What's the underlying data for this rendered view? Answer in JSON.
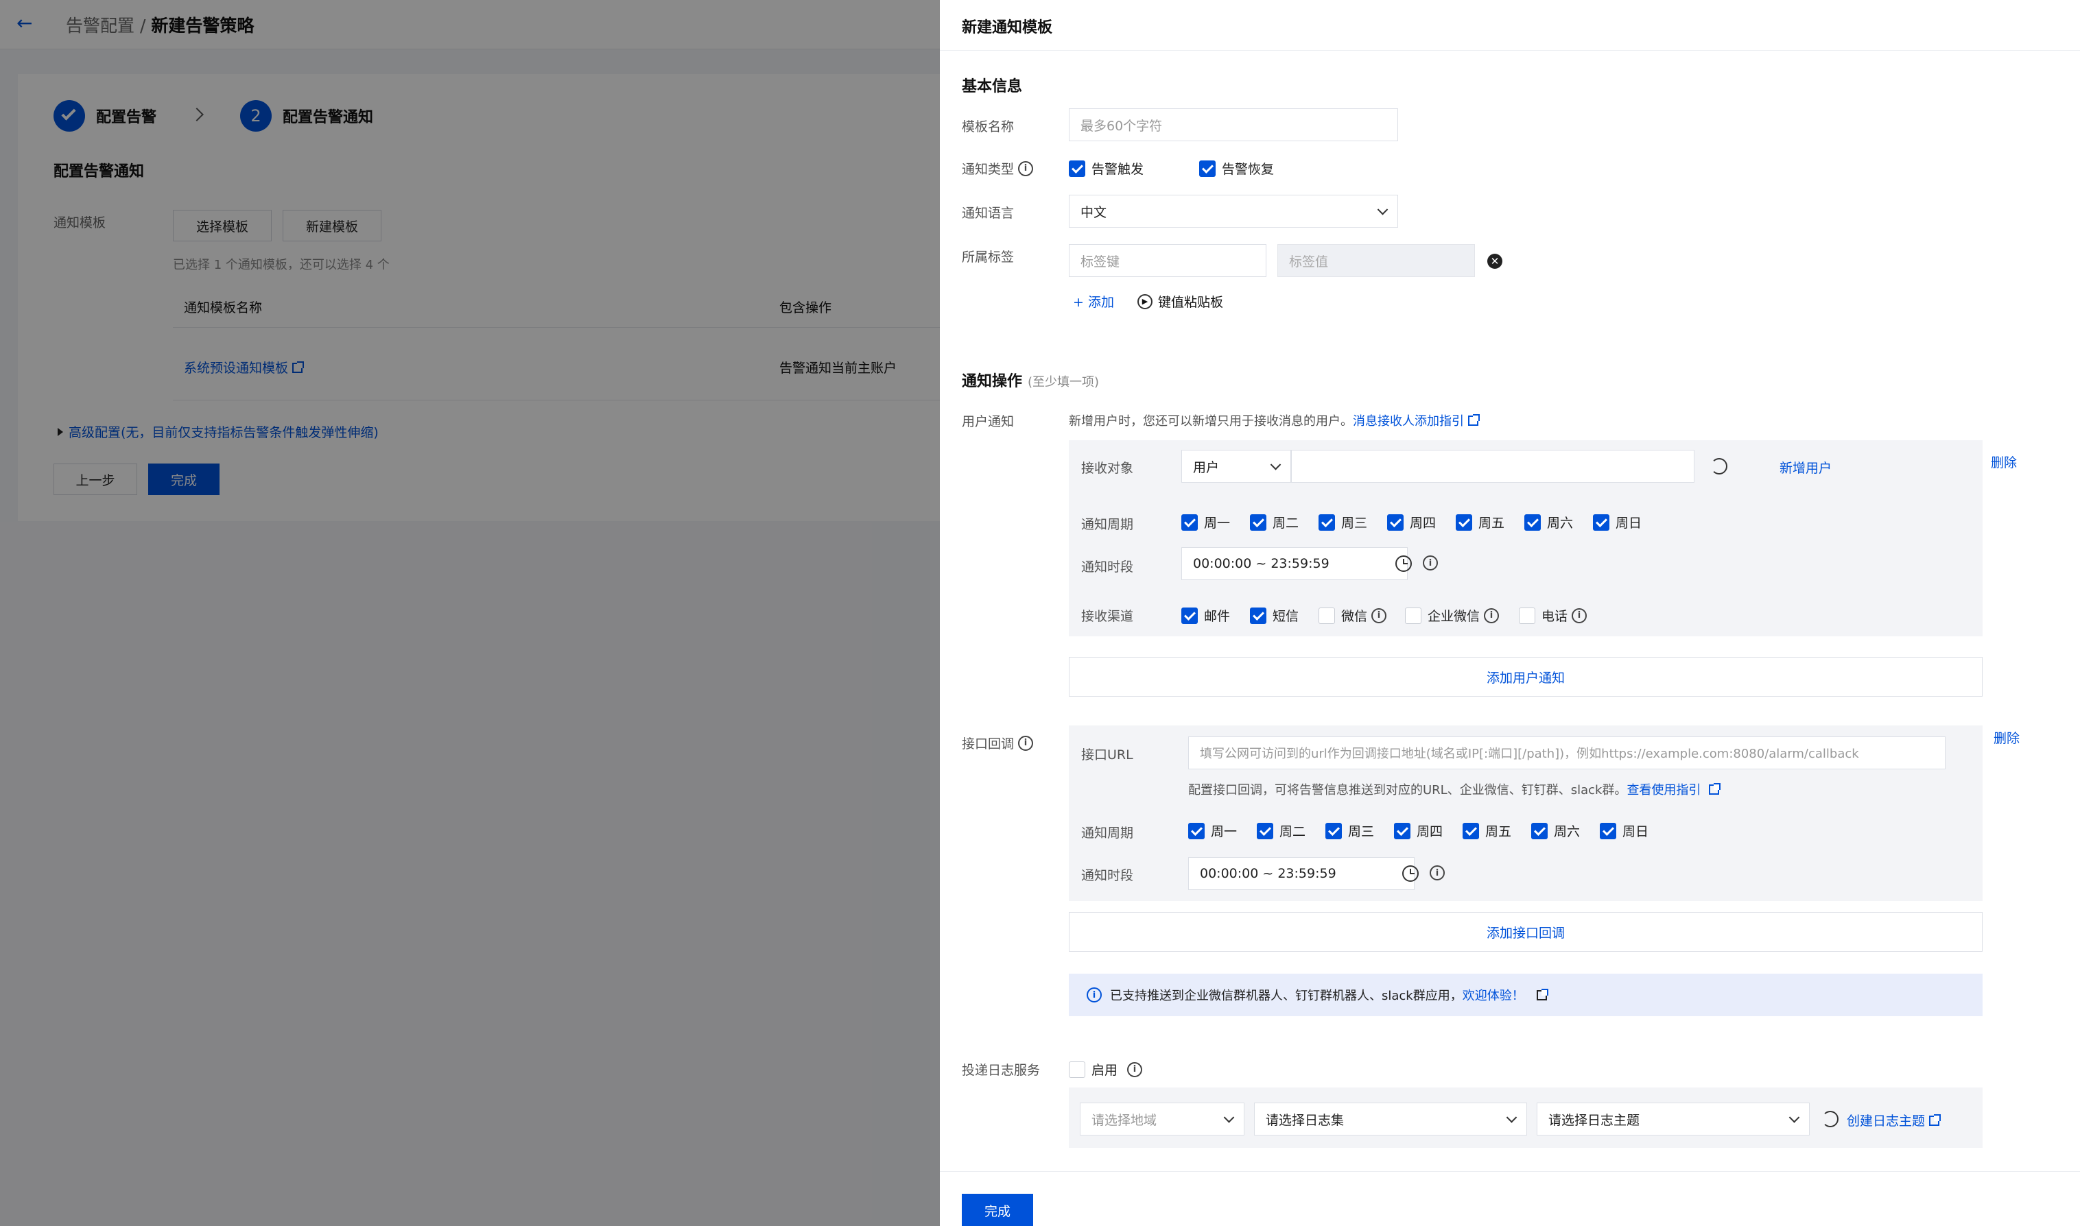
{
  "left": {
    "breadcrumb_parent": "告警配置",
    "breadcrumb_sep": " / ",
    "breadcrumb_current": "新建告警策略",
    "steps": [
      {
        "index": "",
        "label": "配置告警"
      },
      {
        "index": "2",
        "label": "配置告警通知"
      }
    ],
    "section_title": "配置告警通知",
    "template_label": "通知模板",
    "select_template_btn": "选择模板",
    "new_template_btn": "新建模板",
    "selected_hint": "已选择 1 个通知模板，还可以选择 4 个",
    "table": {
      "headers": [
        "通知模板名称",
        "包含操作"
      ],
      "rows": [
        {
          "name": "系统预设通知模板",
          "ops": "告警通知当前主账户"
        }
      ]
    },
    "advanced": "高级配置(无，目前仅支持指标告警条件触发弹性伸缩)",
    "prev_btn": "上一步",
    "finish_btn": "完成"
  },
  "drawer": {
    "title": "新建通知模板",
    "basic": {
      "title": "基本信息",
      "name_label": "模板名称",
      "name_placeholder": "最多60个字符",
      "type_label": "通知类型",
      "type_options": [
        "告警触发",
        "告警恢复"
      ],
      "lang_label": "通知语言",
      "lang_value": "中文",
      "tag_label": "所属标签",
      "tag_key_placeholder": "标签键",
      "tag_value_placeholder": "标签值",
      "add": "添加",
      "paste": "键值粘贴板"
    },
    "ops": {
      "title": "通知操作",
      "subtitle": "(至少填一项)",
      "user_label": "用户通知",
      "user_hint": "新增用户时，您还可以新增只用于接收消息的用户。",
      "user_hint_link": "消息接收人添加指引",
      "delete": "删除",
      "receiver_label": "接收对象",
      "receiver_type": "用户",
      "add_user": "新增用户",
      "period_label": "通知周期",
      "days": [
        "周一",
        "周二",
        "周三",
        "周四",
        "周五",
        "周六",
        "周日"
      ],
      "time_label": "通知时段",
      "time_value": "00:00:00 ~ 23:59:59",
      "channel_label": "接收渠道",
      "channels": [
        {
          "name": "邮件",
          "checked": true
        },
        {
          "name": "短信",
          "checked": true
        },
        {
          "name": "微信",
          "checked": false
        },
        {
          "name": "企业微信",
          "checked": false
        },
        {
          "name": "电话",
          "checked": false
        }
      ],
      "add_user_notice": "添加用户通知",
      "callback_label": "接口回调",
      "url_label": "接口URL",
      "url_placeholder": "填写公网可访问到的url作为回调接口地址(域名或IP[:端口][/path])，例如https://example.com:8080/alarm/callback",
      "callback_hint": "配置接口回调，可将告警信息推送到对应的URL、企业微信、钉钉群、slack群。",
      "callback_hint_link": "查看使用指引",
      "add_callback": "添加接口回调",
      "notice_text": "已支持推送到企业微信群机器人、钉钉群机器人、slack群应用，",
      "notice_link": "欢迎体验！"
    },
    "log": {
      "label": "投递日志服务",
      "enable": "启用",
      "region_placeholder": "请选择地域",
      "logset_placeholder": "请选择日志集",
      "topic_placeholder": "请选择日志主题",
      "create_topic": "创建日志主题"
    },
    "finish": "完成"
  },
  "colors": {
    "primary": "#0052d9",
    "mask": "rgba(0,0,0,0.46)"
  }
}
